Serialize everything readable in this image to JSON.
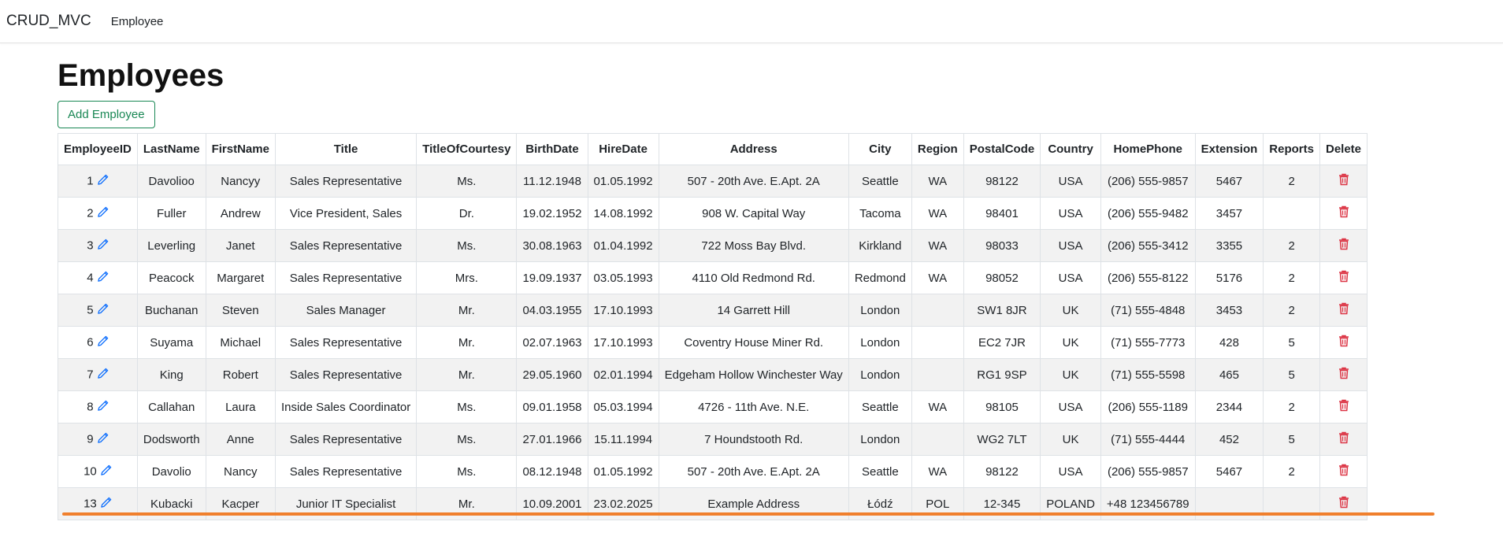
{
  "nav": {
    "brand": "CRUD_MVC",
    "link_employee": "Employee"
  },
  "page": {
    "title": "Employees",
    "add_button": "Add Employee"
  },
  "table": {
    "headers": [
      "EmployeeID",
      "LastName",
      "FirstName",
      "Title",
      "TitleOfCourtesy",
      "BirthDate",
      "HireDate",
      "Address",
      "City",
      "Region",
      "PostalCode",
      "Country",
      "HomePhone",
      "Extension",
      "Reports",
      "Delete"
    ],
    "rows": [
      [
        "1",
        "Davolioo",
        "Nancyy",
        "Sales Representative",
        "Ms.",
        "11.12.1948",
        "01.05.1992",
        "507 - 20th Ave. E.Apt. 2A",
        "Seattle",
        "WA",
        "98122",
        "USA",
        "(206) 555-9857",
        "5467",
        "2"
      ],
      [
        "2",
        "Fuller",
        "Andrew",
        "Vice President, Sales",
        "Dr.",
        "19.02.1952",
        "14.08.1992",
        "908 W. Capital Way",
        "Tacoma",
        "WA",
        "98401",
        "USA",
        "(206) 555-9482",
        "3457",
        ""
      ],
      [
        "3",
        "Leverling",
        "Janet",
        "Sales Representative",
        "Ms.",
        "30.08.1963",
        "01.04.1992",
        "722 Moss Bay Blvd.",
        "Kirkland",
        "WA",
        "98033",
        "USA",
        "(206) 555-3412",
        "3355",
        "2"
      ],
      [
        "4",
        "Peacock",
        "Margaret",
        "Sales Representative",
        "Mrs.",
        "19.09.1937",
        "03.05.1993",
        "4110 Old Redmond Rd.",
        "Redmond",
        "WA",
        "98052",
        "USA",
        "(206) 555-8122",
        "5176",
        "2"
      ],
      [
        "5",
        "Buchanan",
        "Steven",
        "Sales Manager",
        "Mr.",
        "04.03.1955",
        "17.10.1993",
        "14 Garrett Hill",
        "London",
        "",
        "SW1 8JR",
        "UK",
        "(71) 555-4848",
        "3453",
        "2"
      ],
      [
        "6",
        "Suyama",
        "Michael",
        "Sales Representative",
        "Mr.",
        "02.07.1963",
        "17.10.1993",
        "Coventry House Miner Rd.",
        "London",
        "",
        "EC2 7JR",
        "UK",
        "(71) 555-7773",
        "428",
        "5"
      ],
      [
        "7",
        "King",
        "Robert",
        "Sales Representative",
        "Mr.",
        "29.05.1960",
        "02.01.1994",
        "Edgeham Hollow Winchester Way",
        "London",
        "",
        "RG1 9SP",
        "UK",
        "(71) 555-5598",
        "465",
        "5"
      ],
      [
        "8",
        "Callahan",
        "Laura",
        "Inside Sales Coordinator",
        "Ms.",
        "09.01.1958",
        "05.03.1994",
        "4726 - 11th Ave. N.E.",
        "Seattle",
        "WA",
        "98105",
        "USA",
        "(206) 555-1189",
        "2344",
        "2"
      ],
      [
        "9",
        "Dodsworth",
        "Anne",
        "Sales Representative",
        "Ms.",
        "27.01.1966",
        "15.11.1994",
        "7 Houndstooth Rd.",
        "London",
        "",
        "WG2 7LT",
        "UK",
        "(71) 555-4444",
        "452",
        "5"
      ],
      [
        "10",
        "Davolio",
        "Nancy",
        "Sales Representative",
        "Ms.",
        "08.12.1948",
        "01.05.1992",
        "507 - 20th Ave. E.Apt. 2A",
        "Seattle",
        "WA",
        "98122",
        "USA",
        "(206) 555-9857",
        "5467",
        "2"
      ],
      [
        "13",
        "Kubacki",
        "Kacper",
        "Junior IT Specialist",
        "Mr.",
        "10.09.2001",
        "23.02.2025",
        "Example Address",
        "Łódź",
        "POL",
        "12-345",
        "POLAND",
        "+48 123456789",
        "",
        ""
      ]
    ]
  },
  "icons": {
    "edit": "pencil-icon",
    "delete": "trash-icon"
  },
  "colors": {
    "edit_icon": "#0d6efd",
    "delete_icon": "#dc3545",
    "add_button": "#198754",
    "annotation_underline": "#f07f2c"
  }
}
